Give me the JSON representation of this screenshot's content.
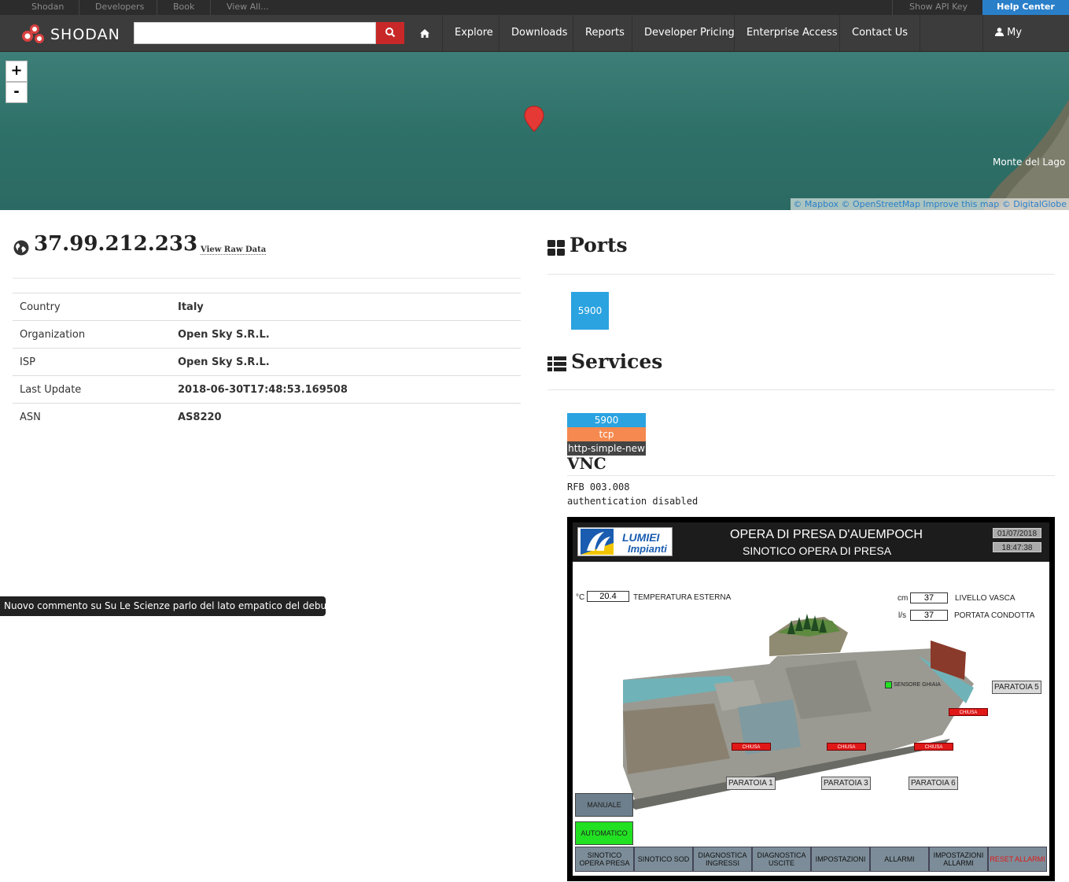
{
  "topbar": {
    "links": [
      "Shodan",
      "Developers",
      "Book",
      "View All..."
    ],
    "api_key": "Show API Key",
    "help_center": "Help Center"
  },
  "navbar": {
    "logo_text": "SHODAN",
    "search_value": "",
    "items": [
      "Explore",
      "Downloads",
      "Reports",
      "Developer Pricing",
      "Enterprise Access",
      "Contact Us"
    ],
    "account": "My Account"
  },
  "map": {
    "zoom_in": "+",
    "zoom_out": "-",
    "place_label": "Monte del Lago",
    "attribution": [
      "© Mapbox",
      "© OpenStreetMap",
      "Improve this map",
      "© DigitalGlobe"
    ]
  },
  "host": {
    "ip": "37.99.212.233",
    "raw_data_link": "View Raw Data",
    "details": [
      {
        "label": "Country",
        "value": "Italy"
      },
      {
        "label": "Organization",
        "value": "Open Sky S.R.L."
      },
      {
        "label": "ISP",
        "value": "Open Sky S.R.L."
      },
      {
        "label": "Last Update",
        "value": "2018-06-30T17:48:53.169508"
      },
      {
        "label": "ASN",
        "value": "AS8220"
      }
    ]
  },
  "ports": {
    "title": "Ports",
    "list": [
      "5900"
    ]
  },
  "services": {
    "title": "Services",
    "port": "5900",
    "protocol": "tcp",
    "module": "http-simple-new",
    "name": "VNC",
    "banner_lines": [
      "RFB 003.008",
      "authentication disabled"
    ]
  },
  "toast": {
    "text": "Nuovo commento su Su Le Scienze parlo del lato empatico del debunkin...."
  },
  "vnc_screen": {
    "logo_line1": "LUMIEI",
    "logo_line2": "Impianti",
    "title": "OPERA DI PRESA D'AUEMPOCH",
    "subtitle": "SINOTICO OPERA DI PRESA",
    "date": "01/07/2018",
    "time": "18:47:38",
    "temp_unit": "°C",
    "temp_value": "20.4",
    "temp_label": "TEMPERATURA ESTERNA",
    "level_unit": "cm",
    "level_value": "37",
    "level_label": "LIVELLO VASCA",
    "flow_unit": "l/s",
    "flow_value": "37",
    "flow_label": "PORTATA CONDOTTA",
    "sensor_label": "SENSORE GHIAIA",
    "chiusa": "CHIUSA",
    "paratoia": [
      "PARATOIA 1",
      "PARATOIA 3",
      "PARATOIA 6",
      "PARATOIA 5"
    ],
    "mode_manual": "MANUALE",
    "mode_auto": "AUTOMATICO",
    "bottom_buttons": [
      "SINOTICO OPERA PRESA",
      "SINOTICO SOD",
      "DIAGNOSTICA INGRESSI",
      "DIAGNOSTICA USCITE",
      "IMPOSTAZIONI",
      "ALLARMI",
      "IMPOSTAZIONI ALLARMI",
      "RESET ALLARMI"
    ]
  },
  "colors": {
    "accent": "#2ba3e0",
    "protocol": "#f5894f",
    "search_button": "#c82828",
    "help_center": "#2a7fc9",
    "auto_mode": "#22e022",
    "alarm": "#e01818"
  }
}
